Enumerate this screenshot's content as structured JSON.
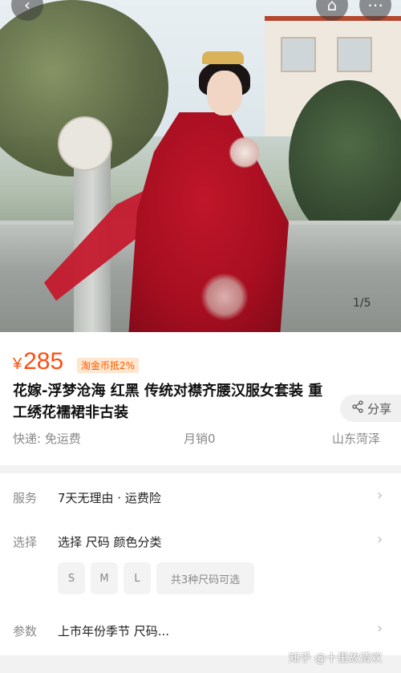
{
  "hero": {
    "page_indicator": "1/5"
  },
  "product": {
    "currency": "¥",
    "price": "285",
    "coin_badge": "淘金币抵2%",
    "title": "花嫁-浮梦沧海 红黑 传统对襟齐腰汉服女套装 重工绣花襦裙非古装",
    "share_label": "分享"
  },
  "meta": {
    "shipping": "快递: 免运费",
    "monthly_sales": "月销0",
    "location": "山东菏泽"
  },
  "options": {
    "service": {
      "label": "服务",
      "value": "7天无理由 · 运费险"
    },
    "select": {
      "label": "选择",
      "value": "选择  尺码 颜色分类",
      "chips": [
        "S",
        "M",
        "L",
        "共3种尺码可选"
      ]
    },
    "params": {
      "label": "参数",
      "value": "上市年份季节 尺码..."
    }
  },
  "watermark": "知乎 @十里故清欢",
  "colors": {
    "accent": "#ff4e0f",
    "badge_bg": "#ffe6cf"
  }
}
